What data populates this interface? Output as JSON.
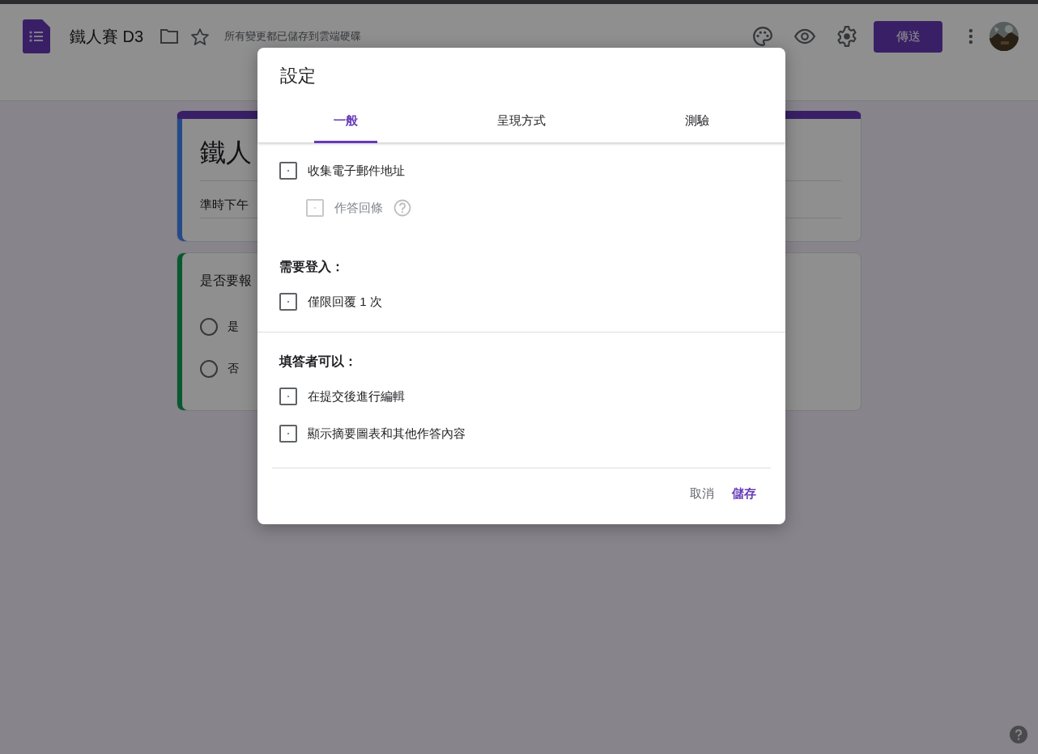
{
  "header": {
    "title": "鐵人賽 D3",
    "save_status": "所有變更都已儲存到雲端硬碟",
    "send_button": "傳送"
  },
  "form_cards": [
    {
      "kind": "title",
      "title": "鐵人",
      "description": "準時下午"
    },
    {
      "kind": "question",
      "question": "是否要報",
      "options": [
        {
          "label": "是",
          "selected": false
        },
        {
          "label": "否",
          "selected": false
        }
      ]
    }
  ],
  "dialog": {
    "title": "設定",
    "tabs": [
      {
        "label": "一般",
        "selected": true
      },
      {
        "label": "呈現方式",
        "selected": false
      },
      {
        "label": "測驗",
        "selected": false
      }
    ],
    "sections": [
      {
        "items": [
          {
            "label": "收集電子郵件地址",
            "checked": false,
            "disabled": false,
            "children": [
              {
                "label": "作答回條",
                "checked": false,
                "disabled": true,
                "help": true
              }
            ]
          }
        ]
      },
      {
        "heading": "需要登入：",
        "items": [
          {
            "label": "僅限回覆 1 次",
            "checked": false,
            "disabled": false
          }
        ]
      },
      {
        "heading": "填答者可以：",
        "items": [
          {
            "label": "在提交後進行編輯",
            "checked": false,
            "disabled": false
          },
          {
            "label": "顯示摘要圖表和其他作答內容",
            "checked": false,
            "disabled": false
          }
        ]
      }
    ],
    "buttons": [
      {
        "label": "取消",
        "kind": "cancel"
      },
      {
        "label": "儲存",
        "kind": "primary"
      }
    ]
  }
}
